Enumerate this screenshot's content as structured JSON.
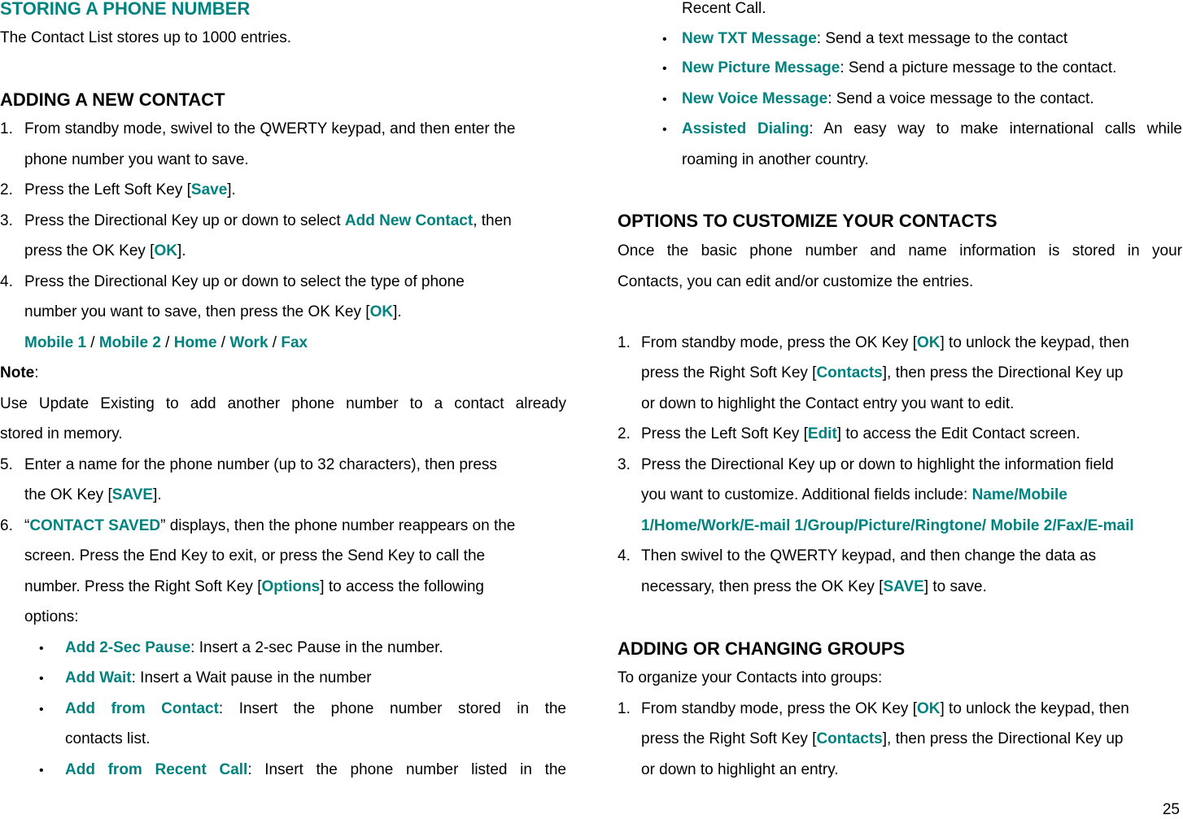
{
  "page_number": "25",
  "colors": {
    "accent": "#00827f",
    "text": "#000000"
  },
  "left": {
    "title": "STORING A PHONE NUMBER",
    "intro": "The Contact List stores up to 1000 entries.",
    "section_heading": "ADDING A NEW CONTACT",
    "steps": {
      "s1": {
        "num": "1.",
        "l1": "From standby mode, swivel to the QWERTY keypad, and then enter the",
        "l2": "phone number you want to save."
      },
      "s2": {
        "num": "2.",
        "pre": "Press the Left Soft Key [",
        "key": "Save",
        "post": "]."
      },
      "s3": {
        "num": "3.",
        "pre": "Press the Directional Key up or down to select ",
        "hl": "Add New Contact",
        "post": ", then",
        "l2pre": "press the OK Key [",
        "l2key": "OK",
        "l2post": "]."
      },
      "s4": {
        "num": "4.",
        "l1": "Press the Directional Key up or down to select the type of phone",
        "l2pre": "number you want to save, then press the OK Key [",
        "l2key": "OK",
        "l2post": "].",
        "types": [
          "Mobile 1",
          "Mobile 2",
          "Home",
          "Work",
          "Fax"
        ],
        "sep": " / "
      },
      "s5": {
        "num": "5.",
        "l1": "Enter a name for the phone number (up to 32 characters), then press",
        "l2pre": "the OK Key [",
        "l2key": "SAVE",
        "l2post": "]."
      },
      "s6": {
        "num": "6.",
        "pre": "“",
        "hl": "CONTACT SAVED",
        "post": "” displays, then the phone number reappears on the",
        "l2": "screen. Press the End Key to exit, or press the Send Key to call the",
        "l3pre": "number. Press the Right Soft Key [",
        "l3key": "Options",
        "l3post": "] to access the following",
        "l4": "options:"
      }
    },
    "note": {
      "label": "Note",
      "colon": ":",
      "l1": "Use Update Existing to add another phone number to a contact already",
      "l2": "stored in memory."
    },
    "options": [
      {
        "name": "Add 2-Sec Pause",
        "desc": ": Insert a 2-sec Pause in the number."
      },
      {
        "name": "Add Wait",
        "desc": ": Insert a Wait pause in the number"
      },
      {
        "name": "Add from Contact",
        "desc": ": Insert the phone number stored in the",
        "cont": "contacts list."
      },
      {
        "name": "Add from Recent Call",
        "desc": ": Insert the phone number listed in the"
      }
    ]
  },
  "right": {
    "cont_line": "Recent Call.",
    "options": [
      {
        "name": "New TXT Message",
        "desc": ": Send a text message to the contact"
      },
      {
        "name": "New Picture Message",
        "desc": ": Send a picture message to the contact."
      },
      {
        "name": "New Voice Message",
        "desc": ": Send a voice message to the contact."
      },
      {
        "name": "Assisted Dialing",
        "desc": ": An easy way to make international calls while",
        "cont": "roaming in another country."
      }
    ],
    "customize": {
      "heading": "OPTIONS TO CUSTOMIZE YOUR CONTACTS",
      "intro_l1": "Once the basic phone number and name information is stored in your",
      "intro_l2": "Contacts, you can edit and/or customize the entries.",
      "s1": {
        "num": "1.",
        "l1pre": "From standby mode, press the OK Key [",
        "l1key": "OK",
        "l1post": "] to unlock the keypad, then",
        "l2pre": "press the Right Soft Key [",
        "l2key": "Contacts",
        "l2post": "], then press the Directional Key up",
        "l3": "or down to highlight the Contact entry you want to edit."
      },
      "s2": {
        "num": "2.",
        "pre": "Press the Left Soft Key [",
        "key": "Edit",
        "post": "] to access the Edit Contact screen."
      },
      "s3": {
        "num": "3.",
        "l1": "Press the Directional Key up or down to highlight the information field",
        "l2pre": "you want to customize. Additional fields include: ",
        "l2hl": "Name/Mobile",
        "l3hl": "1/Home/Work/E-mail 1/Group/Picture/Ringtone/ Mobile 2/Fax/E-mail"
      },
      "s4": {
        "num": "4.",
        "l1": "Then swivel to the QWERTY keypad, and then change the data as",
        "l2pre": "necessary, then press the OK Key [",
        "l2key": "SAVE",
        "l2post": "] to save."
      }
    },
    "groups": {
      "heading": "ADDING OR CHANGING GROUPS",
      "intro": "To organize your Contacts into groups:",
      "s1": {
        "num": "1.",
        "l1pre": "From standby mode, press the OK Key [",
        "l1key": "OK",
        "l1post": "] to unlock the keypad, then",
        "l2pre": "press the Right Soft Key [",
        "l2key": "Contacts",
        "l2post": "], then press the Directional Key up",
        "l3": "or down to highlight an entry."
      }
    }
  }
}
